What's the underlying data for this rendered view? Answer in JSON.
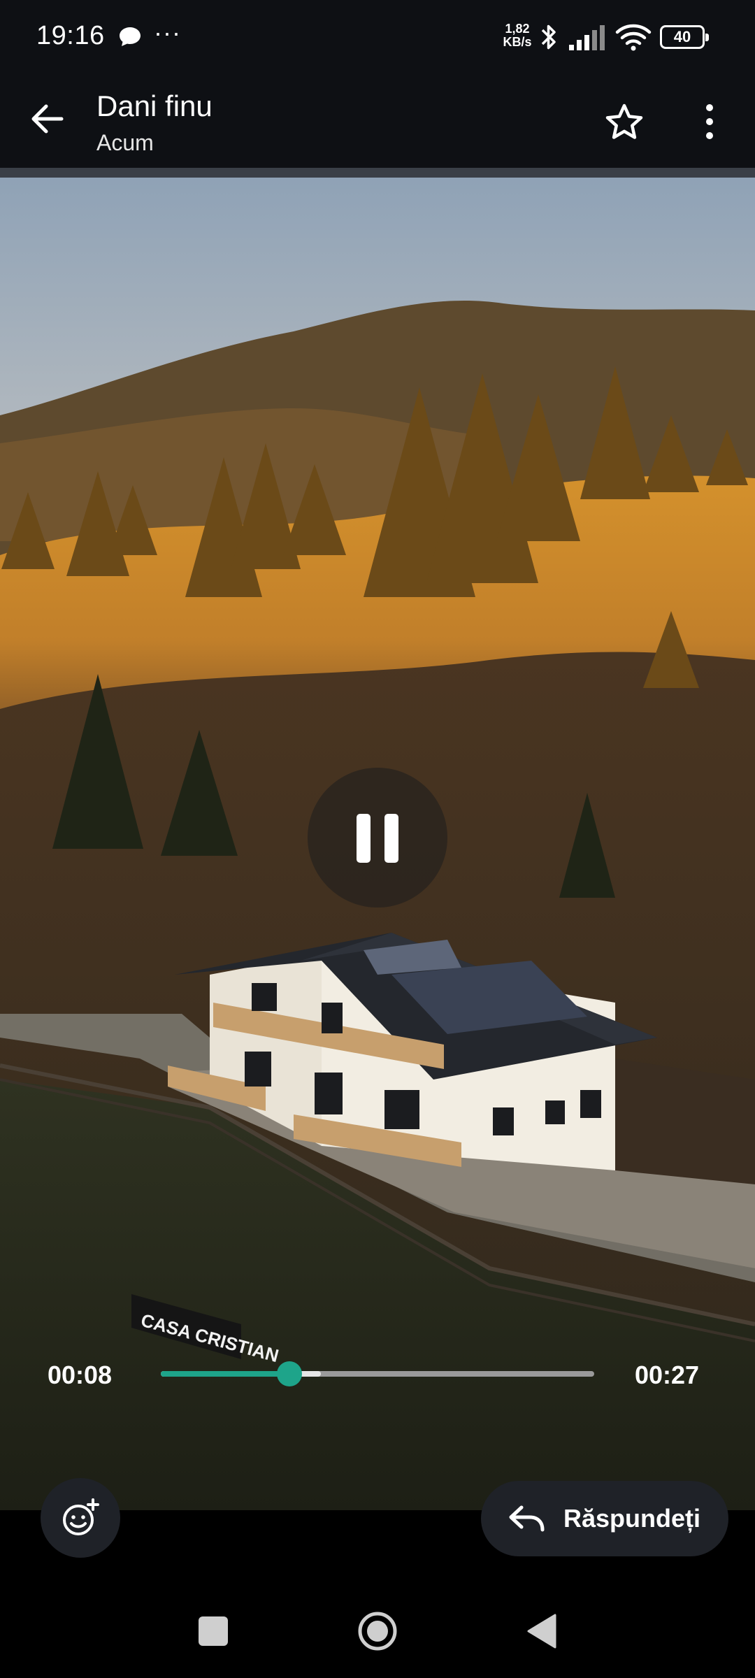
{
  "status_bar": {
    "time": "19:16",
    "dots": "···",
    "speed_value": "1,82",
    "speed_unit": "KB/s",
    "battery": "40",
    "icons": [
      "chat-bubble-icon",
      "bluetooth-icon",
      "signal-icon",
      "wifi-icon",
      "battery-icon"
    ]
  },
  "header": {
    "contact_name": "Dani finu",
    "time": "Acum",
    "icons": [
      "back-arrow-icon",
      "star-icon",
      "more-vert-icon"
    ]
  },
  "player": {
    "current_time": "00:08",
    "total_time": "00:27",
    "progress": 0.296,
    "buffered": 0.37,
    "state": "playing",
    "accent": "#1ea48a",
    "icons": [
      "pause-icon"
    ]
  },
  "video": {
    "sign_text": "CASA CRISTIAN"
  },
  "actions": {
    "reply_label": "Răspundeți",
    "icons": [
      "emoji-add-icon",
      "reply-arrow-icon"
    ]
  },
  "nav": {
    "icons": [
      "recents-square-icon",
      "home-circle-icon",
      "back-triangle-icon"
    ]
  }
}
